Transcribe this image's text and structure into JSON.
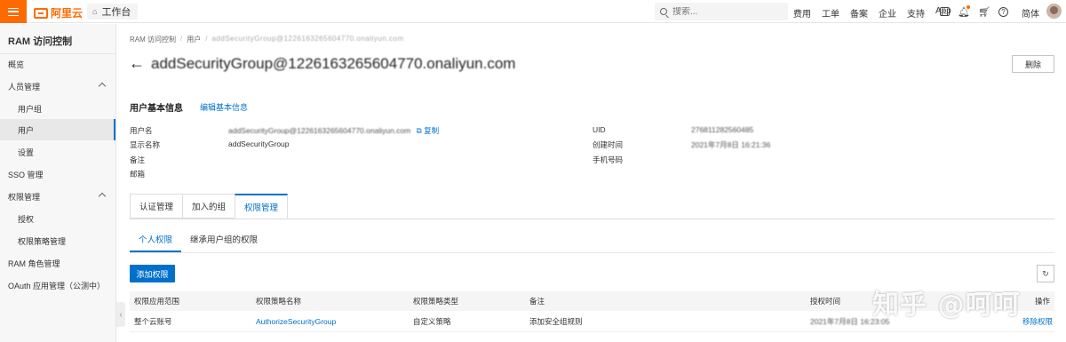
{
  "topbar": {
    "logo_text": "阿里云",
    "workbench": "工作台",
    "search_placeholder": "搜索...",
    "nav": [
      "费用",
      "工单",
      "备案",
      "企业",
      "支持",
      "App"
    ],
    "lang": "简体",
    "brand_color": "#ff6a00"
  },
  "sidebar": {
    "title": "RAM 访问控制",
    "items": [
      {
        "label": "概览"
      },
      {
        "label": "人员管理"
      },
      {
        "label": "用户组"
      },
      {
        "label": "用户"
      },
      {
        "label": "设置"
      },
      {
        "label": "SSO 管理"
      },
      {
        "label": "权限管理"
      },
      {
        "label": "授权"
      },
      {
        "label": "权限策略管理"
      },
      {
        "label": "RAM 角色管理"
      },
      {
        "label": "OAuth 应用管理（公测中）"
      }
    ]
  },
  "breadcrumb": {
    "root": "RAM 访问控制",
    "users": "用户",
    "current": "addSecurityGroup@1226163265604770.onaliyun.com"
  },
  "page": {
    "title": "addSecurityGroup@1226163265604770.onaliyun.com",
    "delete_label": "删除"
  },
  "basic_info": {
    "section_title": "用户基本信息",
    "edit_label": "编辑基本信息",
    "username_label": "用户名",
    "username_value": "addSecurityGroup@1226163265604770.onaliyun.com",
    "copy_label": "复制",
    "display_name_label": "显示名称",
    "display_name_value": "addSecurityGroup",
    "remark_label": "备注",
    "email_label": "邮箱",
    "uid_label": "UID",
    "uid_value": "276811282560485",
    "created_label": "创建时间",
    "created_value": "2021年7月8日 16:21:36",
    "phone_label": "手机号码"
  },
  "tabs": {
    "auth": "认证管理",
    "groups": "加入的组",
    "permissions": "权限管理"
  },
  "subtabs": {
    "personal": "个人权限",
    "inherited": "继承用户组的权限"
  },
  "actions": {
    "add_permission": "添加权限"
  },
  "table": {
    "headers": {
      "scope": "权限应用范围",
      "policy_name": "权限策略名称",
      "policy_type": "权限策略类型",
      "remark": "备注",
      "auth_time": "授权时间",
      "actions": "操作"
    },
    "rows": [
      {
        "scope": "整个云账号",
        "policy_name": "AuthorizeSecurityGroup",
        "policy_type": "自定义策略",
        "remark": "添加安全组规则",
        "auth_time": "2021年7月8日 16:23:05",
        "action": "移除权限"
      }
    ]
  },
  "watermark": "知乎 @呵呵",
  "accent_color": "#0070cc"
}
